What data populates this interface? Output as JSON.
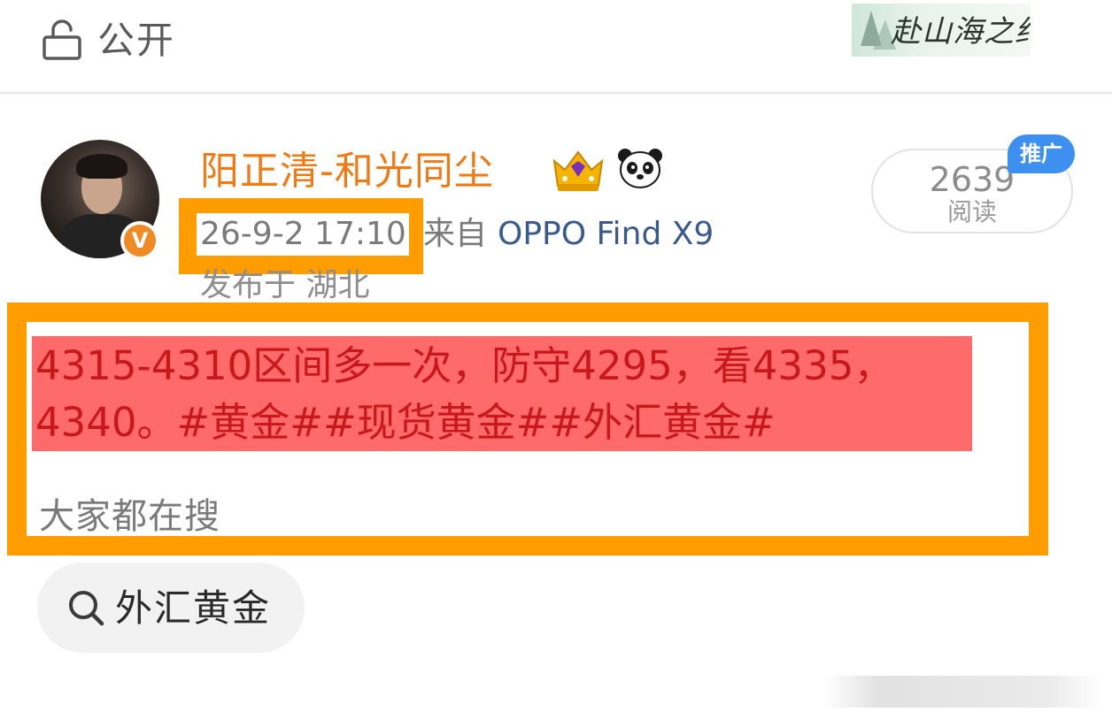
{
  "header": {
    "visibility_label": "公开",
    "banner_text": "赴山海之约"
  },
  "post": {
    "author": {
      "name": "阳正清-和光同尘",
      "badge": "V"
    },
    "timestamp": "26-9-2 17:10",
    "source_prefix": "来自",
    "source_device": "OPPO Find X9",
    "location": "发布于 湖北",
    "read_count": "2639",
    "read_label": "阅读",
    "promo_badge": "推广",
    "content": {
      "line1": "4315-4310区间多一次，防守4295，看4335，",
      "line2_prefix": "4340。",
      "hashtags": [
        "#黄金#",
        "#现货黄金#",
        "#外汇黄金#"
      ]
    },
    "trending_label": "大家都在搜",
    "search_chip": "外汇黄金"
  },
  "colors": {
    "accent_orange": "#ff9d00",
    "username_orange": "#f07a14",
    "highlight_red": "#ff6a6a",
    "content_text": "#c8181b",
    "device_link": "#3b5a8c",
    "promo_blue": "#3d8ff0"
  },
  "icons": [
    "lock-icon",
    "crown-icon",
    "panda-icon",
    "verified-icon",
    "search-icon"
  ]
}
